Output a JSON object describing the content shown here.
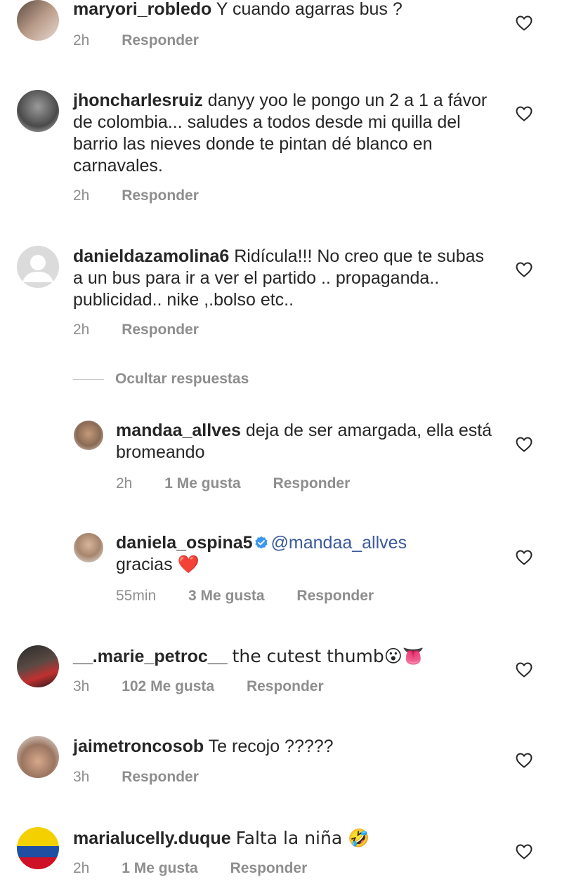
{
  "comments": [
    {
      "user": "maryori_robledo",
      "text": "Y cuando agarras bus ?",
      "time": "2h",
      "likes": "",
      "reply": "Responder"
    },
    {
      "user": "jhoncharlesruiz",
      "text": "danyy yoo le pongo un 2 a 1 a fávor de colombia... saludes a todos desde mi quilla  del barrio las nieves donde te pintan dé blanco en carnavales.",
      "time": "2h",
      "likes": "",
      "reply": "Responder"
    },
    {
      "user": "danieldazamolina6",
      "text": "Ridícula!!! No creo que te subas a  un bus para ir a ver el partido .. propaganda.. publicidad.. nike ,.bolso  etc..",
      "time": "2h",
      "likes": "",
      "reply": "Responder"
    },
    {
      "user": "__.marie_petroc__",
      "text": "the cutest thumb😮👅",
      "time": "3h",
      "likes": "102 Me gusta",
      "reply": "Responder"
    },
    {
      "user": "jaimetroncosob",
      "text": "Te recojo ?????",
      "time": "3h",
      "likes": "",
      "reply": "Responder"
    },
    {
      "user": "marialucelly.duque",
      "text": "Falta la niña 🤣",
      "time": "2h",
      "likes": "1 Me gusta",
      "reply": "Responder"
    }
  ],
  "hide_replies_label": "Ocultar respuestas",
  "replies": [
    {
      "user": "mandaa_allves",
      "text": "deja de ser amargada, ella está bromeando",
      "time": "2h",
      "likes": "1 Me gusta",
      "reply": "Responder"
    },
    {
      "user": "daniela_ospina5",
      "mention": "@mandaa_allves",
      "text": "gracias ❤️",
      "time": "55min",
      "likes": "3 Me gusta",
      "reply": "Responder"
    }
  ],
  "colors": {
    "text": "#262626",
    "meta": "#8e8e8e",
    "mention": "#3b5a9a",
    "verified": "#3897f0"
  }
}
